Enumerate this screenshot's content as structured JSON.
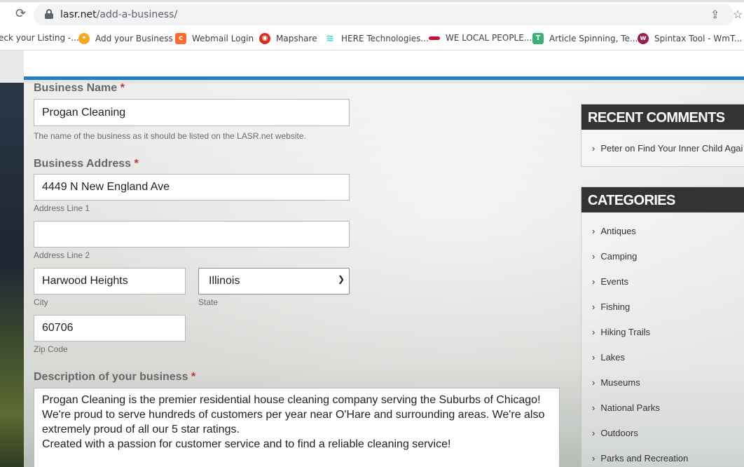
{
  "browser": {
    "url_host": "lasr.net",
    "url_path": "/add-a-business/",
    "bookmarks": [
      {
        "label": "eck your Listing -...",
        "icon": "none",
        "color": "#ffffff"
      },
      {
        "label": "Add your Business",
        "icon": "lightbulb-icon",
        "color": "#f5a623"
      },
      {
        "label": "Webmail Login",
        "icon": "cpanel-icon",
        "color": "#ff6c2c"
      },
      {
        "label": "Mapshare",
        "icon": "mapshare-icon",
        "color": "#d62d20"
      },
      {
        "label": "HERE Technologies...",
        "icon": "here-icon",
        "color": "#48dad0"
      },
      {
        "label": "WE LOCAL PEOPLE...",
        "icon": "flag-icon",
        "color": "#c8102e"
      },
      {
        "label": "Article Spinning, Te...",
        "icon": "t-icon",
        "color": "#3bb273"
      },
      {
        "label": "Spintax Tool - WmT...",
        "icon": "wmt-icon",
        "color": "#9b1c4f"
      }
    ]
  },
  "form": {
    "business_name": {
      "label": "Business Name",
      "required": "*",
      "value": "Progan Cleaning",
      "help": "The name of the business as it should be listed on the LASR.net website."
    },
    "address": {
      "label": "Business Address",
      "required": "*",
      "line1_value": "4449 N New England Ave",
      "line1_caption": "Address Line 1",
      "line2_value": "",
      "line2_caption": "Address Line 2",
      "city_value": "Harwood Heights",
      "city_caption": "City",
      "state_value": "Illinois",
      "state_caption": "State",
      "zip_value": "60706",
      "zip_caption": "Zip Code"
    },
    "description": {
      "label": "Description of your business",
      "required": "*",
      "value": "Progan Cleaning is the premier residential house cleaning company serving the Suburbs of Chicago!\nWe're proud to serve hundreds of customers per year near O'Hare and surrounding areas. We're also\nextremely proud of all our 5 star ratings.\nCreated with a passion for customer service and to find a reliable cleaning service!"
    }
  },
  "sidebar": {
    "recent_comments": {
      "title": "RECENT COMMENTS",
      "items": [
        "Peter on Find Your Inner Child Agai"
      ]
    },
    "categories": {
      "title": "CATEGORIES",
      "items": [
        "Antiques",
        "Camping",
        "Events",
        "Fishing",
        "Hiking Trails",
        "Lakes",
        "Museums",
        "National Parks",
        "Outdoors",
        "Parks and Recreation"
      ]
    }
  },
  "colors": {
    "accent_blue": "#1f7fc8",
    "required_red": "#c0392b",
    "widget_header": "#333333"
  }
}
